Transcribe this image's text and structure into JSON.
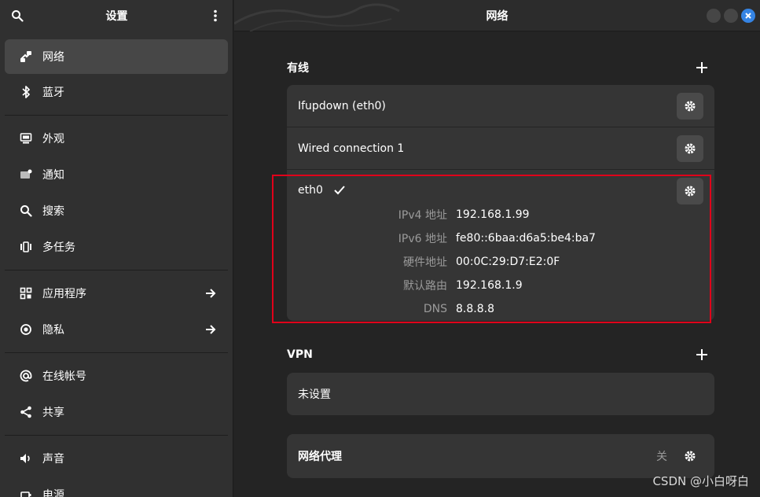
{
  "sidebar": {
    "title": "设置",
    "items": [
      {
        "label": "网络",
        "icon": "network-icon"
      },
      {
        "label": "蓝牙",
        "icon": "bluetooth-icon"
      },
      {
        "label": "外观",
        "icon": "appearance-icon"
      },
      {
        "label": "通知",
        "icon": "notification-icon"
      },
      {
        "label": "搜索",
        "icon": "search-icon"
      },
      {
        "label": "多任务",
        "icon": "multitasking-icon"
      },
      {
        "label": "应用程序",
        "icon": "apps-icon"
      },
      {
        "label": "隐私",
        "icon": "privacy-icon"
      },
      {
        "label": "在线帐号",
        "icon": "online-accounts-icon"
      },
      {
        "label": "共享",
        "icon": "share-icon"
      },
      {
        "label": "声音",
        "icon": "sound-icon"
      },
      {
        "label": "电源",
        "icon": "power-icon"
      }
    ]
  },
  "main": {
    "title": "网络",
    "wired": {
      "title": "有线",
      "connections": [
        {
          "name": "Ifupdown (eth0)"
        },
        {
          "name": "Wired connection 1"
        },
        {
          "name": "eth0",
          "active": true
        }
      ],
      "details": [
        {
          "label": "IPv4 地址",
          "value": "192.168.1.99"
        },
        {
          "label": "IPv6 地址",
          "value": "fe80::6baa:d6a5:be4:ba7"
        },
        {
          "label": "硬件地址",
          "value": "00:0C:29:D7:E2:0F"
        },
        {
          "label": "默认路由",
          "value": "192.168.1.9"
        },
        {
          "label": "DNS",
          "value": "8.8.8.8"
        }
      ]
    },
    "vpn": {
      "title": "VPN",
      "empty": "未设置"
    },
    "proxy": {
      "label": "网络代理",
      "status": "关"
    }
  },
  "watermark": "CSDN @小白呀白",
  "colors": {
    "accent": "#3584e4",
    "highlight": "#e0001a"
  }
}
